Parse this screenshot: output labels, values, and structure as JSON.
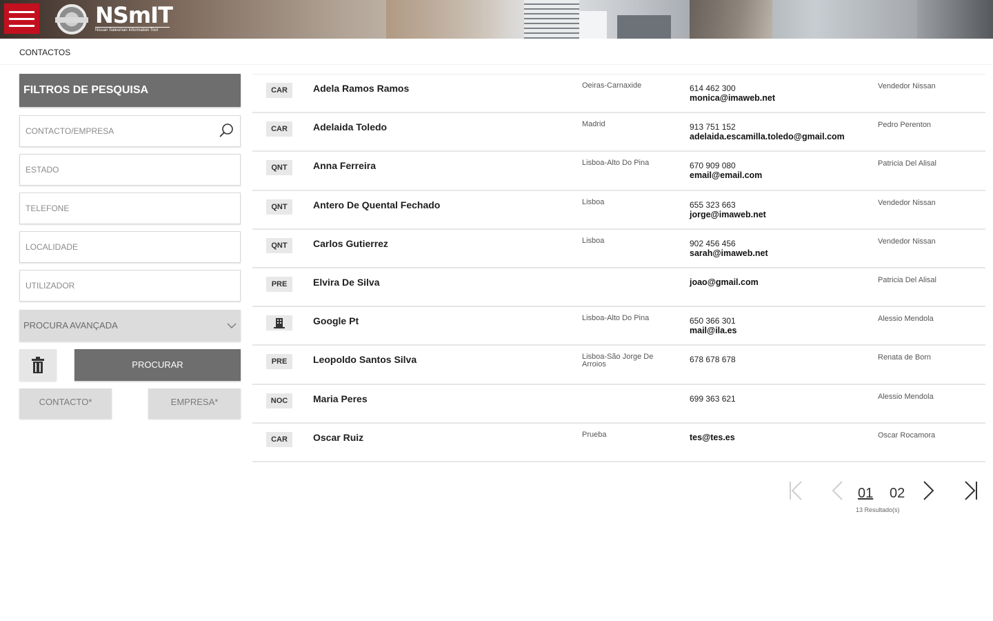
{
  "header": {
    "logo_text": "NSmIT",
    "logo_subtitle": "Nissan Salesman Information Tool"
  },
  "breadcrumb": "CONTACTOS",
  "filters": {
    "title": "FILTROS DE PESQUISA",
    "contact_placeholder": "CONTACTO/EMPRESA",
    "state_placeholder": "ESTADO",
    "phone_placeholder": "TELEFONE",
    "locality_placeholder": "LOCALIDADE",
    "user_placeholder": "UTILIZADOR",
    "advanced_label": "PROCURA AVANÇADA",
    "search_label": "PROCURAR",
    "contact_btn": "CONTACTO*",
    "company_btn": "EMPRESA*"
  },
  "contacts": [
    {
      "badge": "CAR",
      "name": "Adela Ramos Ramos",
      "location": "Oeiras-Carnaxide",
      "phone": "614 462 300",
      "email": "monica@imaweb.net",
      "user": "Vendedor Nissan"
    },
    {
      "badge": "CAR",
      "name": "Adelaida Toledo",
      "location": "Madrid",
      "phone": "913 751 152",
      "email": "adelaida.escamilla.toledo@gmail.com",
      "user": "Pedro Perenton"
    },
    {
      "badge": "QNT",
      "name": "Anna Ferreira",
      "location": "Lisboa-Alto Do Pina",
      "phone": "670 909 080",
      "email": "email@email.com",
      "user": "Patricia Del Alisal"
    },
    {
      "badge": "QNT",
      "name": "Antero De Quental Fechado",
      "location": "Lisboa",
      "phone": "655 323 663",
      "email": "jorge@imaweb.net",
      "user": "Vendedor Nissan"
    },
    {
      "badge": "QNT",
      "name": "Carlos Gutierrez",
      "location": "Lisboa",
      "phone": "902 456 456",
      "email": "sarah@imaweb.net",
      "user": "Vendedor Nissan"
    },
    {
      "badge": "PRE",
      "name": "Elvira De Silva",
      "location": "",
      "phone": "",
      "email": "joao@gmail.com",
      "user": "Patricia Del Alisal"
    },
    {
      "badge": "",
      "badge_icon": "building-icon",
      "name": "Google Pt",
      "location": "Lisboa-Alto Do Pina",
      "phone": "650 366 301",
      "email": "mail@ila.es",
      "user": "Alessio Mendola"
    },
    {
      "badge": "PRE",
      "name": "Leopoldo Santos Silva",
      "location": "Lisboa-São Jorge De Arroios",
      "phone": "678 678 678",
      "email": "",
      "user": "Renata de Born"
    },
    {
      "badge": "NOC",
      "name": "Maria Peres",
      "location": "",
      "phone": "699 363 621",
      "email": "",
      "user": "Alessio Mendola"
    },
    {
      "badge": "CAR",
      "name": "Oscar Ruiz",
      "location": "Prueba",
      "phone": "",
      "email": "tes@tes.es",
      "user": "Oscar Rocamora"
    }
  ],
  "pagination": {
    "pages": [
      "01",
      "02"
    ],
    "current": "01",
    "results": "13 Resultado(s)"
  },
  "colors": {
    "brand_red": "#c3101f",
    "panel_dark": "#6e6e6e",
    "panel_light": "#dcdcdc"
  }
}
